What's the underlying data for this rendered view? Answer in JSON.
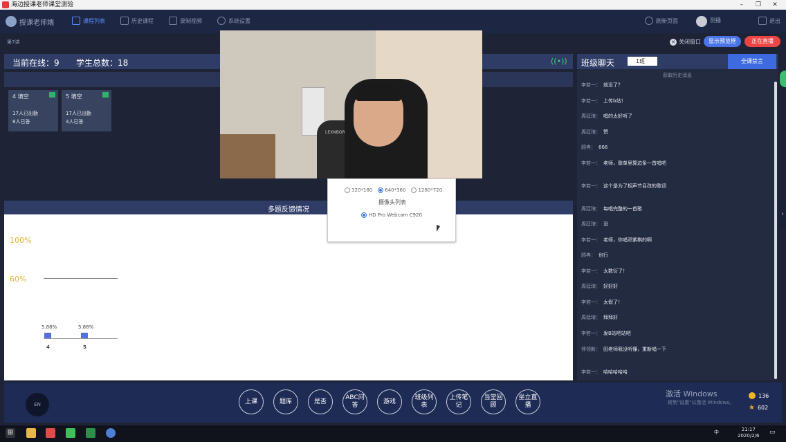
{
  "window": {
    "title": "海边授课老师课堂测验",
    "min": "–",
    "max": "❐",
    "close": "✕"
  },
  "nav": {
    "brand": "授课老师端",
    "items": [
      {
        "label": "课程列表",
        "icon": "calendar-icon"
      },
      {
        "label": "历史课程",
        "icon": "history-icon"
      },
      {
        "label": "录制视频",
        "icon": "video-icon"
      },
      {
        "label": "系统设置",
        "icon": "gear-icon"
      }
    ],
    "refresh": "刷新页面",
    "user": "测播",
    "logout": "退出"
  },
  "lesson": "第7讲",
  "controls": {
    "close_window": "关闭窗口",
    "show_preview": "显示预览框",
    "live": "正在直播"
  },
  "stats": {
    "online": "当前在线：9",
    "total": "学生总数：18"
  },
  "groups": [
    {
      "name": "4 填空",
      "line1": "17人已出勤",
      "line2": "8人已答"
    },
    {
      "name": "5 填空",
      "line1": "17人已出勤",
      "line2": "4人已答"
    }
  ],
  "feedback": {
    "title": "多题反馈情况",
    "pct100": "100%",
    "pct60": "60%"
  },
  "chart_data": {
    "type": "bar",
    "categories": [
      "4",
      "5"
    ],
    "values": [
      5.88,
      5.88
    ],
    "value_labels": [
      "5.88%",
      "5.88%"
    ],
    "ylim": [
      0,
      100
    ],
    "reference_lines": [
      100,
      60
    ]
  },
  "video": {
    "chair_text": "LEXNBORAL"
  },
  "camera": {
    "resolutions": [
      "320*180",
      "640*360",
      "1280*720"
    ],
    "selected_resolution": "640*360",
    "list_title": "摄像头列表",
    "device": "HD Pro Webcam C920"
  },
  "chat": {
    "title": "班级聊天",
    "class_select": "1班",
    "mute_all": "全课禁言",
    "history": "获取历史消息",
    "messages": [
      {
        "who": "李若一：",
        "text": "就没了？"
      },
      {
        "who": "李若一：",
        "text": "上传b站！"
      },
      {
        "who": "周廷琦：",
        "text": "唱的太好听了"
      },
      {
        "who": "周廷琦：",
        "text": "赞"
      },
      {
        "who": "顾冉：",
        "text": "666"
      },
      {
        "who": "李若一：",
        "text": "老师，歌单里算边条一首唱吧"
      },
      {
        "who": "李若一：",
        "text": "这个是为了相声节目改的歌词"
      },
      {
        "who": "周廷琦：",
        "text": "每唱完整的一首歌"
      },
      {
        "who": "周廷琦：",
        "text": "没"
      },
      {
        "who": "李若一：",
        "text": "老师，你唱邓紫棋的啊"
      },
      {
        "who": "顾冉：",
        "text": "也行"
      },
      {
        "who": "李若一：",
        "text": "太数衍了！"
      },
      {
        "who": "周廷琦：",
        "text": "好好好"
      },
      {
        "who": "李若一：",
        "text": "太假了！"
      },
      {
        "who": "周廷琦：",
        "text": "拜拜好"
      },
      {
        "who": "李若一：",
        "text": "发B站吧站吧"
      },
      {
        "who": "俘领新：",
        "text": "田老师我没听懂，重新唱一下"
      },
      {
        "who": "李若一：",
        "text": "哈哈哈哈哈"
      }
    ]
  },
  "toolbar": {
    "en": "EN",
    "buttons": [
      "上课",
      "题库",
      "是否",
      "ABC问答",
      "游戏",
      "班级列表",
      "上传笔记",
      "当堂回顾",
      "坐立直播"
    ]
  },
  "activation": {
    "title": "激活 Windows",
    "sub": "转到\"设置\"以激活 Windows。"
  },
  "coins": "136",
  "stars": "602",
  "taskbar": {
    "time": "21:17",
    "date": "2020/2/6",
    "ime": "中"
  }
}
